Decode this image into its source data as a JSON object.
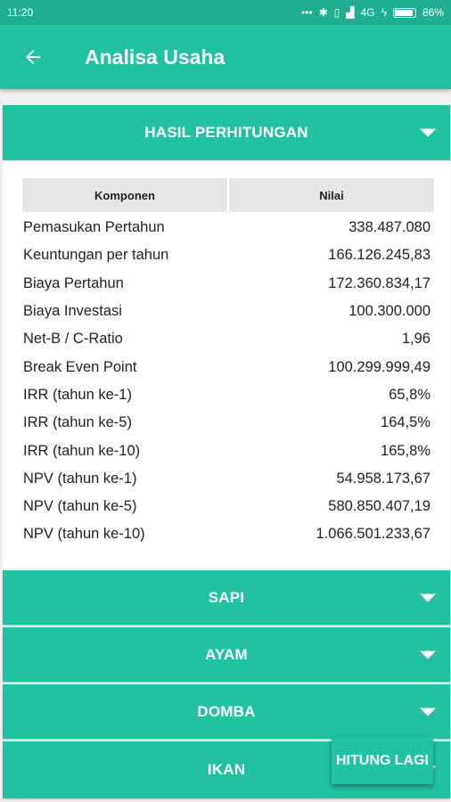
{
  "status": {
    "time": "11:20",
    "network": "4G",
    "battery": "86%"
  },
  "appbar": {
    "title": "Analisa Usaha"
  },
  "sections": {
    "hasil": "HASIL PERHITUNGAN",
    "sapi": "SAPI",
    "ayam": "AYAM",
    "domba": "DOMBA",
    "ikan": "IKAN"
  },
  "table": {
    "headers": {
      "komponen": "Komponen",
      "nilai": "Nilai"
    },
    "rows": [
      {
        "k": "Pemasukan Pertahun",
        "v": "338.487.080"
      },
      {
        "k": "Keuntungan per tahun",
        "v": "166.126.245,83"
      },
      {
        "k": "Biaya Pertahun",
        "v": "172.360.834,17"
      },
      {
        "k": "Biaya Investasi",
        "v": "100.300.000"
      },
      {
        "k": "Net-B / C-Ratio",
        "v": "1,96"
      },
      {
        "k": "Break Even Point",
        "v": "100.299.999,49"
      },
      {
        "k": "IRR (tahun ke-1)",
        "v": "65,8%"
      },
      {
        "k": "IRR (tahun ke-5)",
        "v": "164,5%"
      },
      {
        "k": "IRR (tahun ke-10)",
        "v": "165,8%"
      },
      {
        "k": "NPV (tahun ke-1)",
        "v": "54.958.173,67"
      },
      {
        "k": "NPV (tahun ke-5)",
        "v": "580.850.407,19"
      },
      {
        "k": "NPV (tahun ke-10)",
        "v": "1.066.501.233,67"
      }
    ]
  },
  "fab": {
    "label": "HITUNG LAGI"
  },
  "icons": {
    "back": "arrow-left-icon",
    "chevron": "chevron-down-icon",
    "bluetooth": "bluetooth-icon",
    "signal": "signal-icon",
    "battery": "battery-icon"
  },
  "colors": {
    "primary": "#21c29f",
    "statusbar": "#1fae8f",
    "header_cell": "#e6e6e6"
  }
}
